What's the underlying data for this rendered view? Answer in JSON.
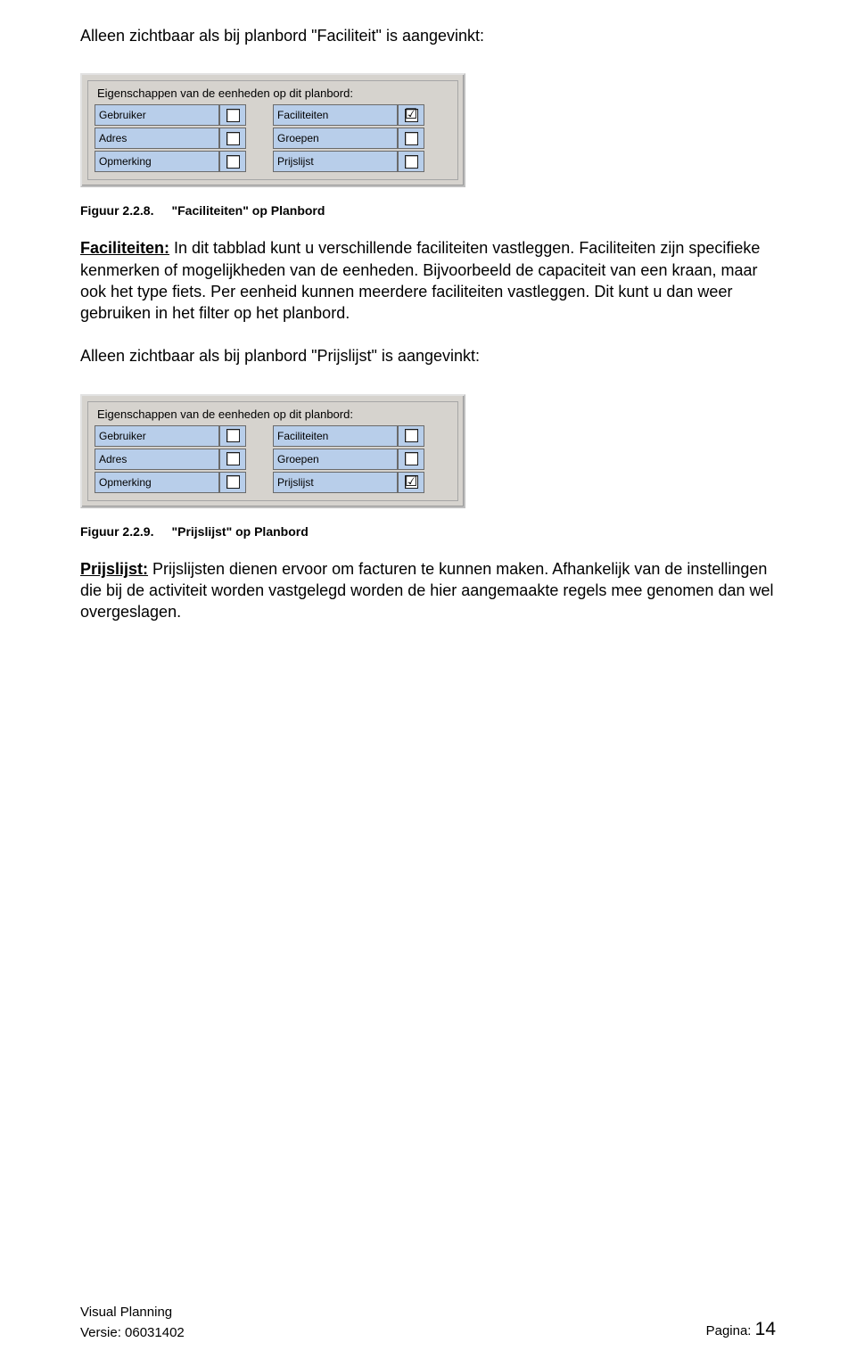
{
  "intro1": "Alleen zichtbaar als bij planbord \"Faciliteit\" is aangevinkt:",
  "panel1": {
    "legend": "Eigenschappen van de eenheden op dit planbord:",
    "rows": [
      {
        "left": "Gebruiker",
        "leftChecked": false,
        "right": "Faciliteiten",
        "rightChecked": true
      },
      {
        "left": "Adres",
        "leftChecked": false,
        "right": "Groepen",
        "rightChecked": false
      },
      {
        "left": "Opmerking",
        "leftChecked": false,
        "right": "Prijslijst",
        "rightChecked": false
      }
    ]
  },
  "caption1": {
    "num": "Figuur 2.2.8.",
    "text": "\"Faciliteiten\" op Planbord"
  },
  "para2_bold": "Faciliteiten:",
  "para2_rest": " In dit tabblad kunt u verschillende faciliteiten vastleggen. Faciliteiten zijn specifieke kenmerken of mogelijkheden van de eenheden. Bijvoorbeeld de capaciteit van een kraan, maar ook het type fiets. Per eenheid kunnen meerdere faciliteiten vastleggen. Dit kunt u dan weer gebruiken in het filter op het planbord.",
  "intro3": "Alleen zichtbaar als bij planbord \"Prijslijst\" is aangevinkt:",
  "panel2": {
    "legend": "Eigenschappen van de eenheden op dit planbord:",
    "rows": [
      {
        "left": "Gebruiker",
        "leftChecked": false,
        "right": "Faciliteiten",
        "rightChecked": false
      },
      {
        "left": "Adres",
        "leftChecked": false,
        "right": "Groepen",
        "rightChecked": false
      },
      {
        "left": "Opmerking",
        "leftChecked": false,
        "right": "Prijslijst",
        "rightChecked": true
      }
    ]
  },
  "caption2": {
    "num": "Figuur 2.2.9.",
    "text": "\"Prijslijst\" op Planbord"
  },
  "para4_bold": "Prijslijst:",
  "para4_rest": " Prijslijsten dienen ervoor om facturen te kunnen maken. Afhankelijk van de instellingen die bij de activiteit worden vastgelegd worden de hier aangemaakte regels mee genomen dan wel overgeslagen.",
  "footer": {
    "left1": "Visual Planning",
    "left2": "Versie: 06031402",
    "rightLabel": "Pagina: ",
    "rightNum": "14"
  }
}
